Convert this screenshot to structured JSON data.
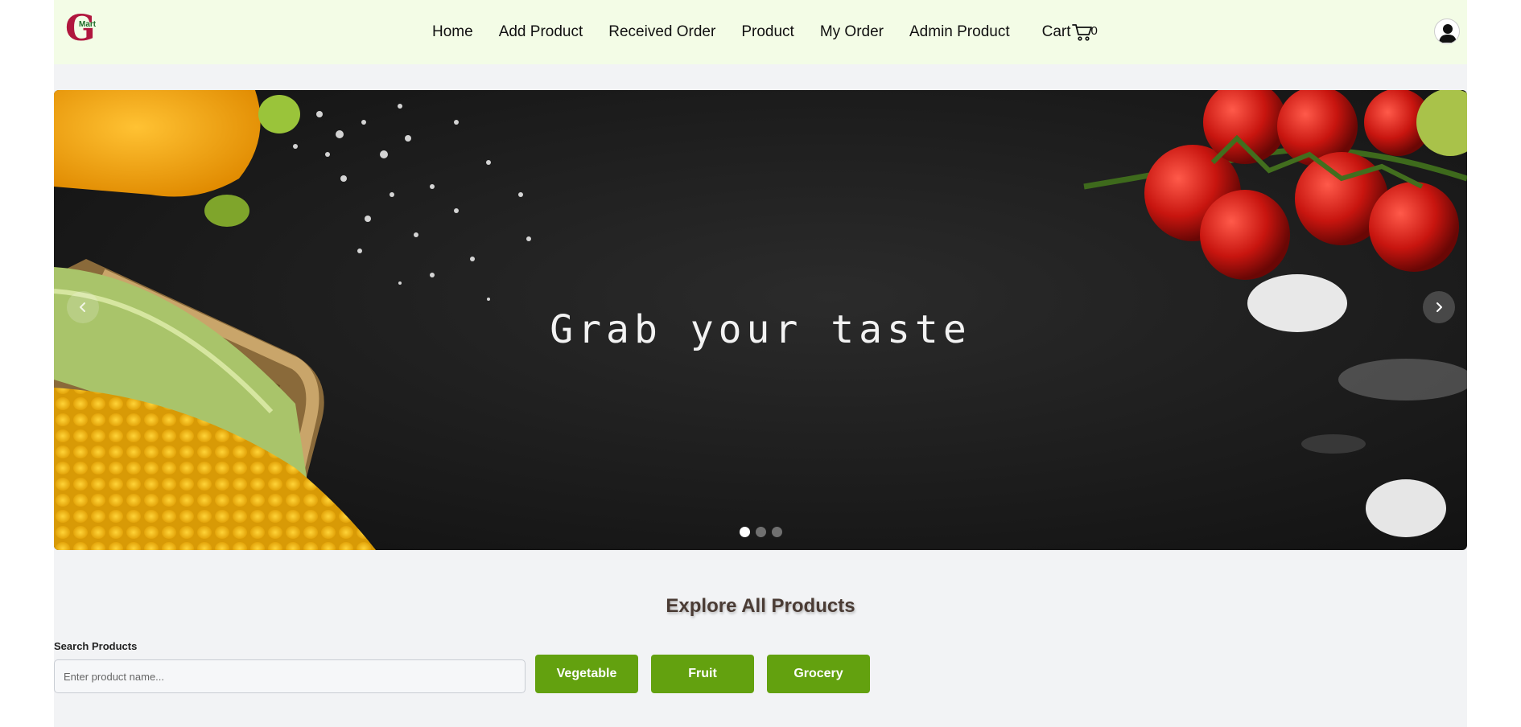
{
  "brand": {
    "logo_letter": "G",
    "logo_sub": "Mart",
    "colors": {
      "logo": "#b0163e",
      "logo_sub": "#1f6d2a",
      "nav_bg": "#f3fce6",
      "accent": "#63a10f"
    }
  },
  "nav": {
    "links": [
      "Home",
      "Add Product",
      "Received Order",
      "Product",
      "My Order",
      "Admin Product"
    ],
    "cart_label": "Cart",
    "cart_count": "0",
    "cart_icon": "cart-icon",
    "avatar_icon": "user-avatar-icon"
  },
  "carousel": {
    "headline": "Grab your taste",
    "slide_count": 3,
    "active_slide": 1,
    "prev_icon": "chevron-left-icon",
    "next_icon": "chevron-right-icon"
  },
  "explore": {
    "title": "Explore All Products",
    "search_label": "Search Products",
    "search_placeholder": "Enter product name...",
    "search_value": "",
    "categories": [
      "Vegetable",
      "Fruit",
      "Grocery"
    ]
  }
}
